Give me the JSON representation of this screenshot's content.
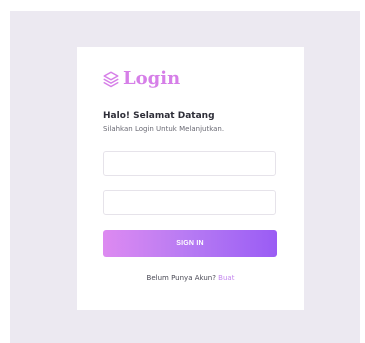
{
  "brand": {
    "icon": "layers-icon",
    "title": "Login",
    "color": "#d67fe8"
  },
  "greeting": {
    "title": "Halo! Selamat Datang",
    "subtitle": "Silahkan Login Untuk Melanjutkan."
  },
  "form": {
    "username_value": "",
    "password_value": "",
    "signin_label": "SIGN IN",
    "button_gradient": [
      "#dd8af1",
      "#9a5cf4"
    ]
  },
  "footer": {
    "prompt": "Belum Punya Akun?",
    "link_label": "Buat",
    "link_color": "#c487ee"
  }
}
